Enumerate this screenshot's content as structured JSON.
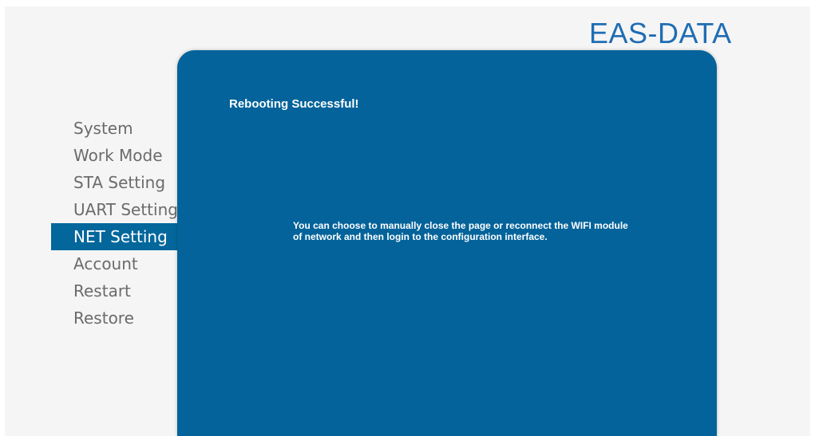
{
  "header": {
    "brand": "EAS-DATA"
  },
  "sidebar": {
    "items": [
      {
        "label": "System",
        "active": false
      },
      {
        "label": "Work Mode",
        "active": false
      },
      {
        "label": "STA Setting",
        "active": false
      },
      {
        "label": "UART Setting",
        "active": false
      },
      {
        "label": "NET Setting",
        "active": true
      },
      {
        "label": "Account",
        "active": false
      },
      {
        "label": "Restart",
        "active": false
      },
      {
        "label": "Restore",
        "active": false
      }
    ]
  },
  "main": {
    "title": "Rebooting Successful!",
    "message": "You can choose to manually close the page or reconnect the WIFI module of network and then login to the configuration interface."
  },
  "colors": {
    "brand": "#1f6db3",
    "panel": "#03639a",
    "active_nav": "#03679c",
    "nav_text": "#6b6b6b"
  }
}
